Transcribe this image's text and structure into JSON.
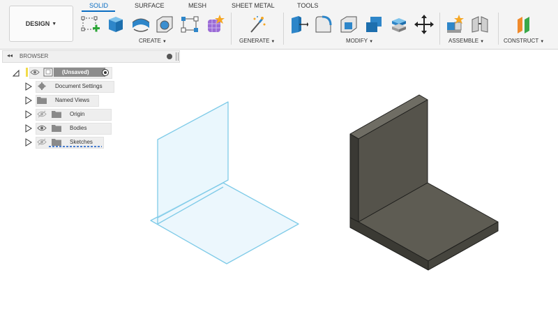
{
  "toolbar": {
    "design_label": "DESIGN",
    "tabs": [
      "SOLID",
      "SURFACE",
      "MESH",
      "SHEET METAL",
      "TOOLS"
    ],
    "groups": [
      "CREATE",
      "GENERATE",
      "MODIFY",
      "ASSEMBLE",
      "CONSTRUCT"
    ]
  },
  "browser": {
    "title": "BROWSER",
    "root_label": "(Unsaved)",
    "items": [
      {
        "label": "Document Settings",
        "icon": "gear-icon"
      },
      {
        "label": "Named Views",
        "icon": "folder-icon"
      },
      {
        "label": "Origin",
        "icon": "folder-icon",
        "visibility": "hidden"
      },
      {
        "label": "Bodies",
        "icon": "folder-icon",
        "visibility": "visible"
      },
      {
        "label": "Sketches",
        "icon": "folder-icon",
        "visibility": "hidden"
      }
    ]
  },
  "colors": {
    "accent": "#0a6dc2",
    "surface_stroke": "#7fcbe8",
    "surface_fill": "#d9f0fb",
    "solid_light": "#5c5a52",
    "solid_dark": "#3e3d37"
  }
}
